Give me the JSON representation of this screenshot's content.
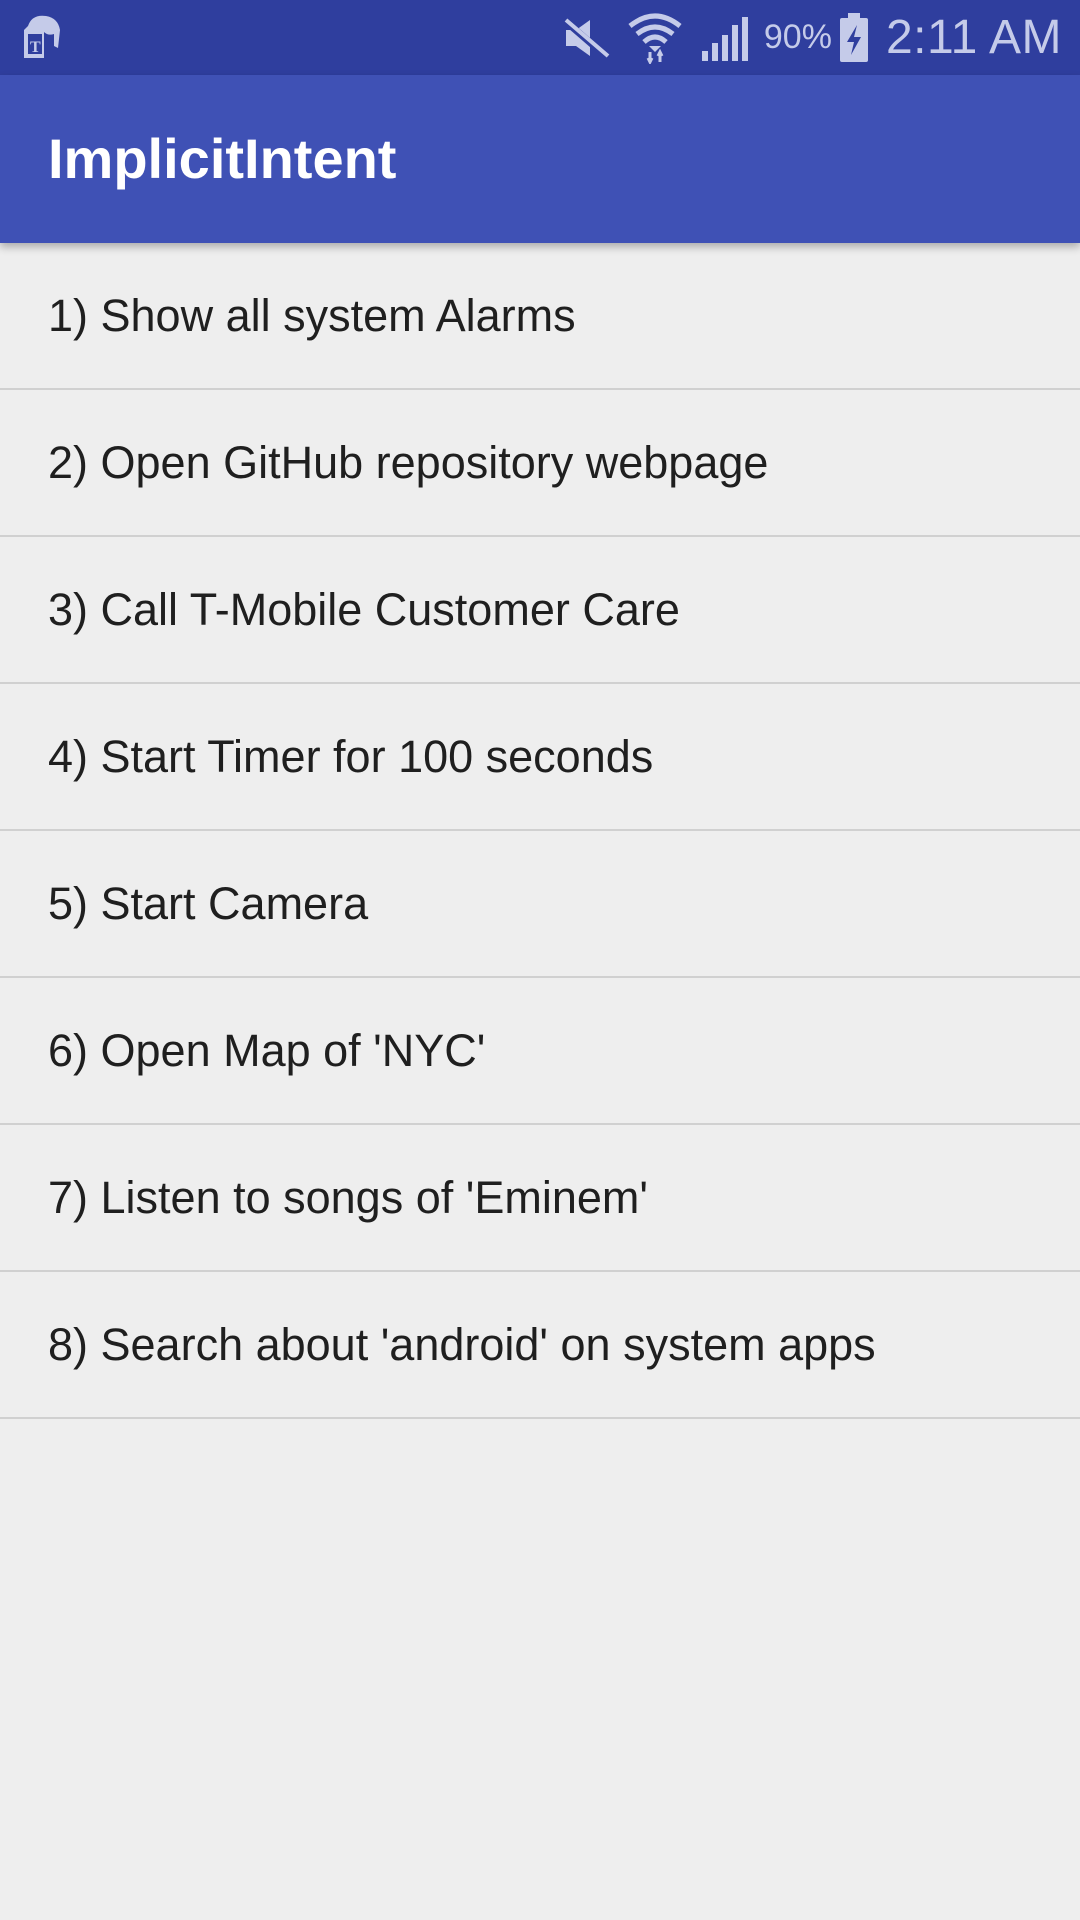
{
  "status_bar": {
    "carrier_icon": "t-mobile-app-icon",
    "icons": [
      "mute-icon",
      "wifi-icon",
      "signal-icon",
      "battery-charging-icon"
    ],
    "battery_percent": "90%",
    "time": "2:11 AM",
    "background_color": "#2f3e9e"
  },
  "app_bar": {
    "title": "ImplicitIntent",
    "background_color": "#3f51b5"
  },
  "list": {
    "items": [
      {
        "label": "1) Show all system Alarms"
      },
      {
        "label": "2) Open GitHub repository webpage"
      },
      {
        "label": "3) Call T-Mobile Customer Care"
      },
      {
        "label": "4) Start Timer for 100 seconds"
      },
      {
        "label": "5) Start Camera"
      },
      {
        "label": "6) Open Map of 'NYC'"
      },
      {
        "label": "7) Listen to songs of 'Eminem'"
      },
      {
        "label": "8) Search about 'android' on system apps"
      }
    ]
  }
}
